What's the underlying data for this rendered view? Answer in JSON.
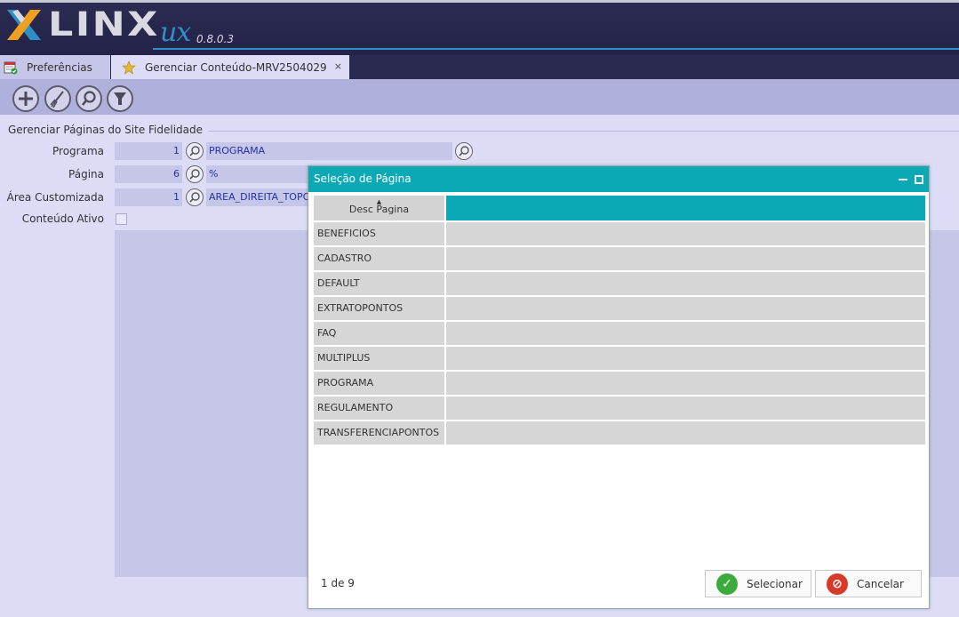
{
  "header": {
    "brand": "LINX",
    "product": "ux",
    "version": "0.8.0.3"
  },
  "tabs": [
    {
      "label": "Preferências",
      "icon": "calendar-check-icon",
      "active": false
    },
    {
      "label": "Gerenciar Conteúdo-MRV2504029",
      "icon": "star-icon",
      "active": true,
      "close": "×"
    }
  ],
  "toolbar": {
    "buttons": [
      {
        "icon": "add-icon"
      },
      {
        "icon": "broom-clear-icon"
      },
      {
        "icon": "search-icon"
      },
      {
        "icon": "filter-icon"
      }
    ]
  },
  "form": {
    "section_title": "Gerenciar Páginas do Site Fidelidade",
    "programa": {
      "label": "Programa",
      "code": "1",
      "desc": "PROGRAMA"
    },
    "pagina": {
      "label": "Página",
      "code": "6",
      "desc": "%"
    },
    "area": {
      "label": "Área Customizada",
      "code": "1",
      "desc": "AREA_DIREITA_TOPO_T"
    },
    "ativo": {
      "label": "Conteúdo Ativo",
      "checked": false
    }
  },
  "dialog": {
    "title": "Seleção de Página",
    "column_header": "Desc Pagina",
    "rows": [
      "BENEFICIOS",
      "CADASTRO",
      "DEFAULT",
      "EXTRATOPONTOS",
      "FAQ",
      "MULTIPLUS",
      "PROGRAMA",
      "REGULAMENTO",
      "TRANSFERENCIAPONTOS"
    ],
    "pager": "1 de 9",
    "select_label": "Selecionar",
    "cancel_label": "Cancelar"
  },
  "colors": {
    "accent": "#0aa9b5",
    "header_bg": "#2c2b52",
    "page_bg": "#dcdcf6",
    "field_bg": "#c6c6e8"
  }
}
